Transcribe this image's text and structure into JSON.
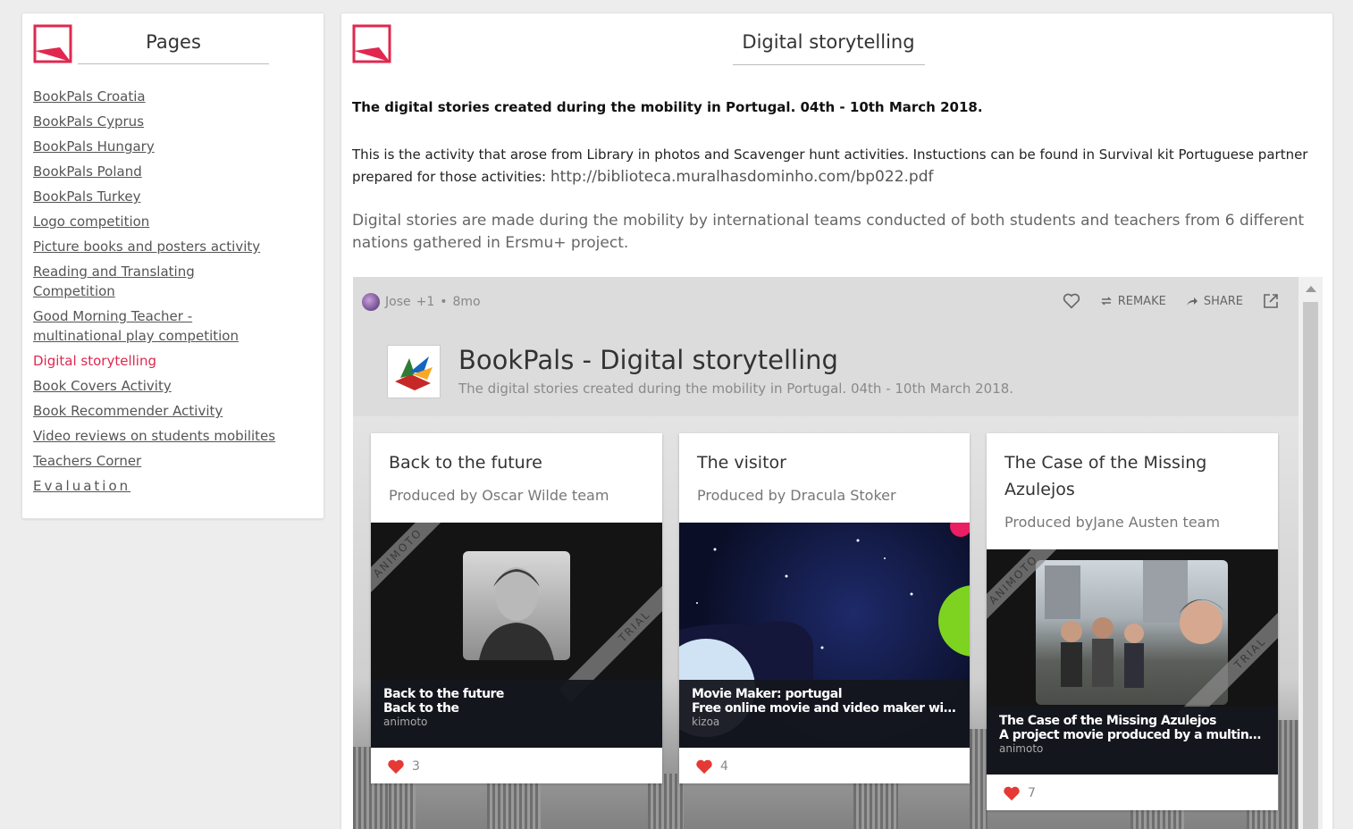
{
  "sidebar": {
    "title": "Pages",
    "items": [
      {
        "label": "BookPals Croatia"
      },
      {
        "label": "BookPals Cyprus"
      },
      {
        "label": "BookPals Hungary"
      },
      {
        "label": "BookPals Poland"
      },
      {
        "label": "BookPals Turkey"
      },
      {
        "label": "Logo competition"
      },
      {
        "label": "Picture books and posters activity"
      },
      {
        "label": "Reading and Translating Competition"
      },
      {
        "label": "Good Morning Teacher - multinational play competition"
      },
      {
        "label": "Digital storytelling"
      },
      {
        "label": "Book Covers Activity"
      },
      {
        "label": "Book Recommender Activity"
      },
      {
        "label": "Video reviews on students mobilites"
      },
      {
        "label": "Teachers Corner"
      },
      {
        "label": "Evaluation"
      }
    ]
  },
  "main": {
    "title": "Digital storytelling",
    "intro_bold": "The digital stories created during the mobility in Portugal. 04th - 10th March 2018.",
    "intro_text": "This is the activity that arose from Library in photos and Scavenger hunt activities. Instuctions can be found in Survival kit Portuguese partner prepared for those activities: ",
    "intro_link": "http://biblioteca.muralhasdominho.com/bp022.pdf",
    "intro_desc": "Digital stories are made during the mobility by international teams conducted of both students and teachers from 6 different nations gathered in Ersmu+ project."
  },
  "embed": {
    "author": "Jose",
    "extra_authors": "+1",
    "separator": "•",
    "age": "8mo",
    "remake_label": "REMAKE",
    "share_label": "SHARE",
    "board_title": "BookPals - Digital storytelling",
    "board_subtitle": "The digital stories created during the mobility in Portugal. 04th - 10th March 2018.",
    "cards": [
      {
        "title": "Back to the future",
        "subtitle": "Produced by Oscar Wilde team",
        "thumb_title": "Back to the future",
        "thumb_desc": "Back to the",
        "thumb_source": "animoto",
        "ribbon_top": "ANIMOTO",
        "ribbon_bottom": "TRIAL",
        "likes": "3"
      },
      {
        "title": "The visitor",
        "subtitle": "Produced by Dracula Stoker",
        "thumb_title": "Movie Maker: portugal",
        "thumb_desc": "Free online movie and video maker with p...",
        "thumb_source": "kizoa",
        "likes": "4"
      },
      {
        "title": "The Case of the Missing Azulejos",
        "subtitle": "Produced byJane Austen team",
        "thumb_title": "The Case of the Missing Azulejos",
        "thumb_desc": "A project movie produced by a multinatio...",
        "thumb_source": "animoto",
        "ribbon_top": "ANIMOTO",
        "ribbon_bottom": "TRIAL",
        "likes": "7"
      }
    ]
  },
  "colors": {
    "accent": "#e0284f",
    "heart": "#e53935"
  }
}
